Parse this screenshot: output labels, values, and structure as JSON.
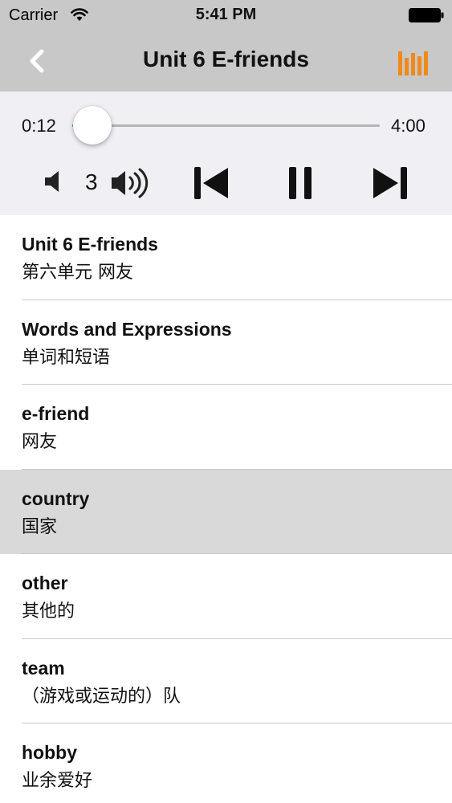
{
  "status_bar": {
    "carrier": "Carrier",
    "time": "5:41 PM",
    "icons": [
      "wifi-icon",
      "battery-icon"
    ]
  },
  "nav": {
    "title": "Unit 6  E-friends",
    "back_icon": "chevron-left-icon",
    "playlist_icon": "bars-icon",
    "accent_color": "#f08a1c"
  },
  "player": {
    "elapsed": "0:12",
    "total": "4:00",
    "progress_fraction": 0.05,
    "volume": "3",
    "slider_color": "#1a9fe0",
    "controls": [
      "volume-down-icon",
      "volume-up-icon",
      "previous-track-icon",
      "pause-icon",
      "next-track-icon"
    ]
  },
  "list": {
    "items": [
      {
        "title": "Unit 6 E-friends",
        "subtitle": "第六单元 网友",
        "selected": false
      },
      {
        "title": "Words and Expressions",
        "subtitle": "单词和短语",
        "selected": false
      },
      {
        "title": "e-friend",
        "subtitle": "网友",
        "selected": false
      },
      {
        "title": "country",
        "subtitle": "国家",
        "selected": true
      },
      {
        "title": "other",
        "subtitle": "其他的",
        "selected": false
      },
      {
        "title": "team",
        "subtitle": "（游戏或运动的）队",
        "selected": false
      },
      {
        "title": "hobby",
        "subtitle": "业余爱好",
        "selected": false
      }
    ]
  }
}
